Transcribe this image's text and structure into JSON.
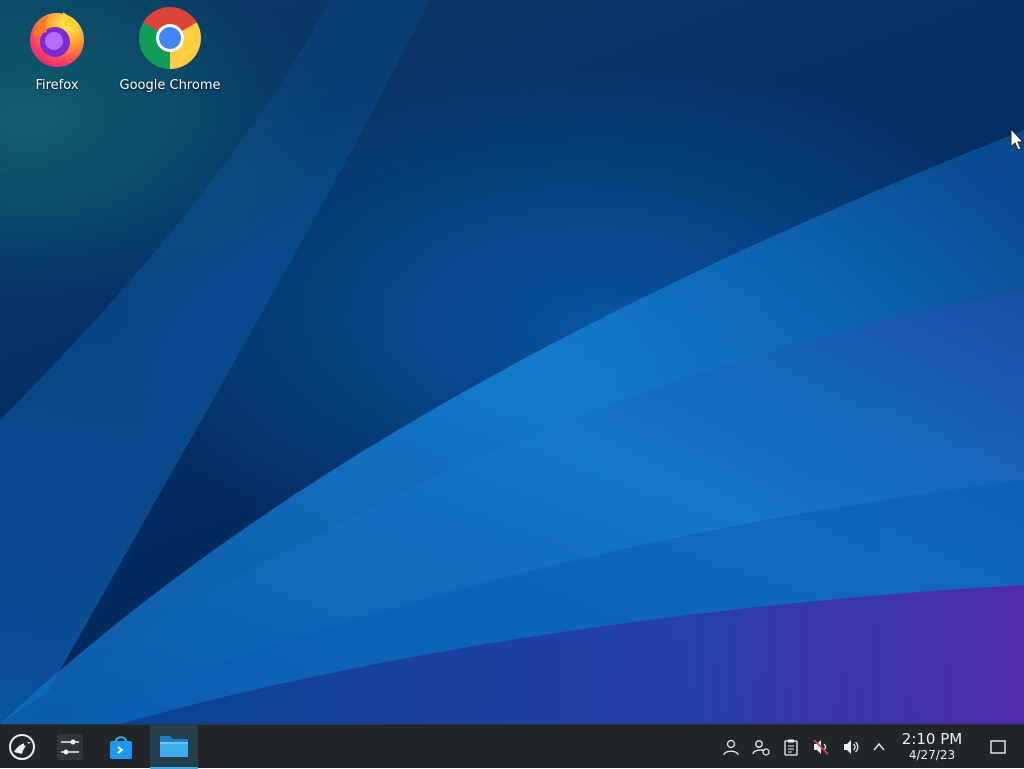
{
  "desktop": {
    "icons": [
      {
        "label": "Firefox",
        "icon": "firefox-icon"
      },
      {
        "label": "Google Chrome",
        "icon": "chrome-icon"
      }
    ]
  },
  "taskbar": {
    "launcher_icon": "kde-application-launcher-icon",
    "pinned": [
      {
        "icon": "system-settings-icon"
      },
      {
        "icon": "discover-store-icon"
      },
      {
        "icon": "file-manager-icon",
        "active": true
      }
    ],
    "tray": [
      {
        "icon": "user-icon"
      },
      {
        "icon": "user-switch-icon"
      },
      {
        "icon": "clipboard-icon"
      },
      {
        "icon": "volume-muted-icon"
      },
      {
        "icon": "volume-icon"
      },
      {
        "icon": "chevron-up-icon"
      }
    ],
    "clock": {
      "time": "2:10 PM",
      "date": "4/27/23"
    },
    "show_desktop_icon": "show-desktop-icon"
  },
  "colors": {
    "taskbar": "#232629",
    "accent": "#3daee9",
    "wallpaper_blue": "#0a5ab0",
    "wallpaper_purple": "#8a14b8"
  }
}
